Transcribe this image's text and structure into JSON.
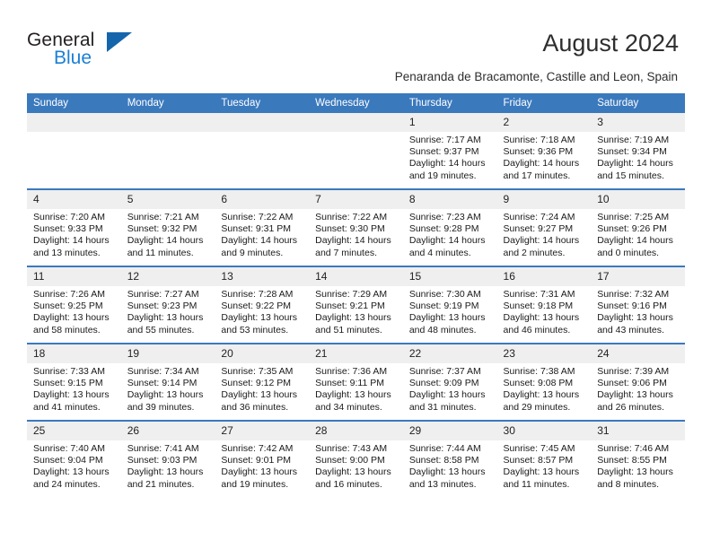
{
  "brand": {
    "name_top": "General",
    "name_bottom": "Blue",
    "triangle_color": "#1565ad",
    "blue_color": "#1b7fd4"
  },
  "header": {
    "title": "August 2024",
    "subtitle": "Penaranda de Bracamonte, Castille and Leon, Spain",
    "accent_color": "#3b79bd"
  },
  "calendar": {
    "weekday_headers": [
      "Sunday",
      "Monday",
      "Tuesday",
      "Wednesday",
      "Thursday",
      "Friday",
      "Saturday"
    ],
    "weeks": [
      [
        {
          "day": "",
          "empty": true,
          "sunrise": "",
          "sunset": "",
          "daylight_line1": "",
          "daylight_line2": ""
        },
        {
          "day": "",
          "empty": true,
          "sunrise": "",
          "sunset": "",
          "daylight_line1": "",
          "daylight_line2": ""
        },
        {
          "day": "",
          "empty": true,
          "sunrise": "",
          "sunset": "",
          "daylight_line1": "",
          "daylight_line2": ""
        },
        {
          "day": "",
          "empty": true,
          "sunrise": "",
          "sunset": "",
          "daylight_line1": "",
          "daylight_line2": ""
        },
        {
          "day": "1",
          "empty": false,
          "sunrise": "Sunrise: 7:17 AM",
          "sunset": "Sunset: 9:37 PM",
          "daylight_line1": "Daylight: 14 hours",
          "daylight_line2": "and 19 minutes."
        },
        {
          "day": "2",
          "empty": false,
          "sunrise": "Sunrise: 7:18 AM",
          "sunset": "Sunset: 9:36 PM",
          "daylight_line1": "Daylight: 14 hours",
          "daylight_line2": "and 17 minutes."
        },
        {
          "day": "3",
          "empty": false,
          "sunrise": "Sunrise: 7:19 AM",
          "sunset": "Sunset: 9:34 PM",
          "daylight_line1": "Daylight: 14 hours",
          "daylight_line2": "and 15 minutes."
        }
      ],
      [
        {
          "day": "4",
          "empty": false,
          "sunrise": "Sunrise: 7:20 AM",
          "sunset": "Sunset: 9:33 PM",
          "daylight_line1": "Daylight: 14 hours",
          "daylight_line2": "and 13 minutes."
        },
        {
          "day": "5",
          "empty": false,
          "sunrise": "Sunrise: 7:21 AM",
          "sunset": "Sunset: 9:32 PM",
          "daylight_line1": "Daylight: 14 hours",
          "daylight_line2": "and 11 minutes."
        },
        {
          "day": "6",
          "empty": false,
          "sunrise": "Sunrise: 7:22 AM",
          "sunset": "Sunset: 9:31 PM",
          "daylight_line1": "Daylight: 14 hours",
          "daylight_line2": "and 9 minutes."
        },
        {
          "day": "7",
          "empty": false,
          "sunrise": "Sunrise: 7:22 AM",
          "sunset": "Sunset: 9:30 PM",
          "daylight_line1": "Daylight: 14 hours",
          "daylight_line2": "and 7 minutes."
        },
        {
          "day": "8",
          "empty": false,
          "sunrise": "Sunrise: 7:23 AM",
          "sunset": "Sunset: 9:28 PM",
          "daylight_line1": "Daylight: 14 hours",
          "daylight_line2": "and 4 minutes."
        },
        {
          "day": "9",
          "empty": false,
          "sunrise": "Sunrise: 7:24 AM",
          "sunset": "Sunset: 9:27 PM",
          "daylight_line1": "Daylight: 14 hours",
          "daylight_line2": "and 2 minutes."
        },
        {
          "day": "10",
          "empty": false,
          "sunrise": "Sunrise: 7:25 AM",
          "sunset": "Sunset: 9:26 PM",
          "daylight_line1": "Daylight: 14 hours",
          "daylight_line2": "and 0 minutes."
        }
      ],
      [
        {
          "day": "11",
          "empty": false,
          "sunrise": "Sunrise: 7:26 AM",
          "sunset": "Sunset: 9:25 PM",
          "daylight_line1": "Daylight: 13 hours",
          "daylight_line2": "and 58 minutes."
        },
        {
          "day": "12",
          "empty": false,
          "sunrise": "Sunrise: 7:27 AM",
          "sunset": "Sunset: 9:23 PM",
          "daylight_line1": "Daylight: 13 hours",
          "daylight_line2": "and 55 minutes."
        },
        {
          "day": "13",
          "empty": false,
          "sunrise": "Sunrise: 7:28 AM",
          "sunset": "Sunset: 9:22 PM",
          "daylight_line1": "Daylight: 13 hours",
          "daylight_line2": "and 53 minutes."
        },
        {
          "day": "14",
          "empty": false,
          "sunrise": "Sunrise: 7:29 AM",
          "sunset": "Sunset: 9:21 PM",
          "daylight_line1": "Daylight: 13 hours",
          "daylight_line2": "and 51 minutes."
        },
        {
          "day": "15",
          "empty": false,
          "sunrise": "Sunrise: 7:30 AM",
          "sunset": "Sunset: 9:19 PM",
          "daylight_line1": "Daylight: 13 hours",
          "daylight_line2": "and 48 minutes."
        },
        {
          "day": "16",
          "empty": false,
          "sunrise": "Sunrise: 7:31 AM",
          "sunset": "Sunset: 9:18 PM",
          "daylight_line1": "Daylight: 13 hours",
          "daylight_line2": "and 46 minutes."
        },
        {
          "day": "17",
          "empty": false,
          "sunrise": "Sunrise: 7:32 AM",
          "sunset": "Sunset: 9:16 PM",
          "daylight_line1": "Daylight: 13 hours",
          "daylight_line2": "and 43 minutes."
        }
      ],
      [
        {
          "day": "18",
          "empty": false,
          "sunrise": "Sunrise: 7:33 AM",
          "sunset": "Sunset: 9:15 PM",
          "daylight_line1": "Daylight: 13 hours",
          "daylight_line2": "and 41 minutes."
        },
        {
          "day": "19",
          "empty": false,
          "sunrise": "Sunrise: 7:34 AM",
          "sunset": "Sunset: 9:14 PM",
          "daylight_line1": "Daylight: 13 hours",
          "daylight_line2": "and 39 minutes."
        },
        {
          "day": "20",
          "empty": false,
          "sunrise": "Sunrise: 7:35 AM",
          "sunset": "Sunset: 9:12 PM",
          "daylight_line1": "Daylight: 13 hours",
          "daylight_line2": "and 36 minutes."
        },
        {
          "day": "21",
          "empty": false,
          "sunrise": "Sunrise: 7:36 AM",
          "sunset": "Sunset: 9:11 PM",
          "daylight_line1": "Daylight: 13 hours",
          "daylight_line2": "and 34 minutes."
        },
        {
          "day": "22",
          "empty": false,
          "sunrise": "Sunrise: 7:37 AM",
          "sunset": "Sunset: 9:09 PM",
          "daylight_line1": "Daylight: 13 hours",
          "daylight_line2": "and 31 minutes."
        },
        {
          "day": "23",
          "empty": false,
          "sunrise": "Sunrise: 7:38 AM",
          "sunset": "Sunset: 9:08 PM",
          "daylight_line1": "Daylight: 13 hours",
          "daylight_line2": "and 29 minutes."
        },
        {
          "day": "24",
          "empty": false,
          "sunrise": "Sunrise: 7:39 AM",
          "sunset": "Sunset: 9:06 PM",
          "daylight_line1": "Daylight: 13 hours",
          "daylight_line2": "and 26 minutes."
        }
      ],
      [
        {
          "day": "25",
          "empty": false,
          "sunrise": "Sunrise: 7:40 AM",
          "sunset": "Sunset: 9:04 PM",
          "daylight_line1": "Daylight: 13 hours",
          "daylight_line2": "and 24 minutes."
        },
        {
          "day": "26",
          "empty": false,
          "sunrise": "Sunrise: 7:41 AM",
          "sunset": "Sunset: 9:03 PM",
          "daylight_line1": "Daylight: 13 hours",
          "daylight_line2": "and 21 minutes."
        },
        {
          "day": "27",
          "empty": false,
          "sunrise": "Sunrise: 7:42 AM",
          "sunset": "Sunset: 9:01 PM",
          "daylight_line1": "Daylight: 13 hours",
          "daylight_line2": "and 19 minutes."
        },
        {
          "day": "28",
          "empty": false,
          "sunrise": "Sunrise: 7:43 AM",
          "sunset": "Sunset: 9:00 PM",
          "daylight_line1": "Daylight: 13 hours",
          "daylight_line2": "and 16 minutes."
        },
        {
          "day": "29",
          "empty": false,
          "sunrise": "Sunrise: 7:44 AM",
          "sunset": "Sunset: 8:58 PM",
          "daylight_line1": "Daylight: 13 hours",
          "daylight_line2": "and 13 minutes."
        },
        {
          "day": "30",
          "empty": false,
          "sunrise": "Sunrise: 7:45 AM",
          "sunset": "Sunset: 8:57 PM",
          "daylight_line1": "Daylight: 13 hours",
          "daylight_line2": "and 11 minutes."
        },
        {
          "day": "31",
          "empty": false,
          "sunrise": "Sunrise: 7:46 AM",
          "sunset": "Sunset: 8:55 PM",
          "daylight_line1": "Daylight: 13 hours",
          "daylight_line2": "and 8 minutes."
        }
      ]
    ]
  }
}
